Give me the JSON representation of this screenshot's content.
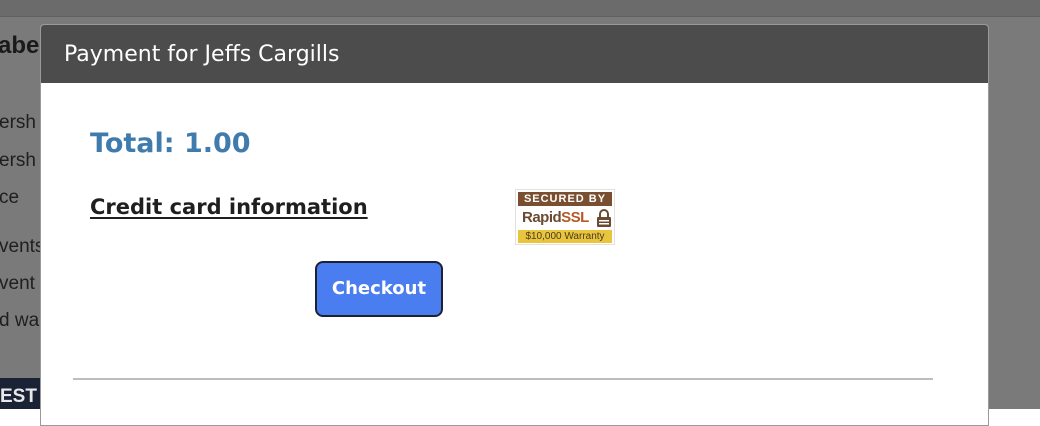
{
  "background": {
    "heading_fragment": "abe",
    "text_fragments": [
      "ersh",
      "ersh",
      "ce",
      "vents",
      "vent",
      "d wa"
    ],
    "banner_fragment": "EST",
    "colors": {
      "overlay": "#7a7a7a",
      "banner": "#1a2236"
    }
  },
  "modal": {
    "title": "Payment for Jeffs Cargills",
    "total": "Total: 1.00",
    "credit_card_link": "Credit card information",
    "checkout_label": "Checkout",
    "ssl_badge": {
      "top": "SECURED BY",
      "brand_rapid": "Rapid",
      "brand_ssl": "SSL",
      "warranty": "$10,000 Warranty"
    },
    "colors": {
      "header_bg": "#4c4c4c",
      "total_text": "#3f7bad",
      "checkout_bg": "#4a7ef0"
    }
  }
}
